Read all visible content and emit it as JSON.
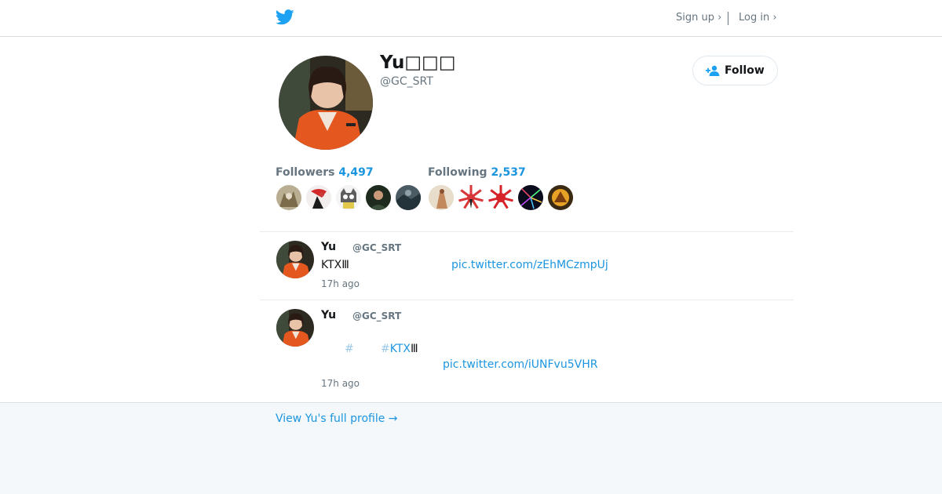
{
  "header": {
    "signup_label": "Sign up ›",
    "login_label": "Log in ›"
  },
  "profile": {
    "name": "Yu□□□",
    "handle": "@GC_SRT",
    "follow_label": "Follow",
    "followers_label": "Followers",
    "followers_count": "4,497",
    "following_label": "Following",
    "following_count": "2,537"
  },
  "tweets": [
    {
      "name": "Yu",
      "handle": "@GC_SRT",
      "text": "KTXⅢ",
      "link": "pic.twitter.com/zEhMCzmpUj",
      "time": "17h ago"
    },
    {
      "name": "Yu",
      "handle": "@GC_SRT",
      "hash1": "#",
      "hash2": "#",
      "tag": "KTX",
      "tag_suffix": "Ⅲ",
      "link": "pic.twitter.com/iUNFvu5VHR",
      "time": "17h ago"
    }
  ],
  "footer": {
    "full_profile_label": "View Yu's full profile →"
  },
  "colors": {
    "brand": "#1da1f2",
    "link": "#1b95e0",
    "muted": "#66757f"
  }
}
